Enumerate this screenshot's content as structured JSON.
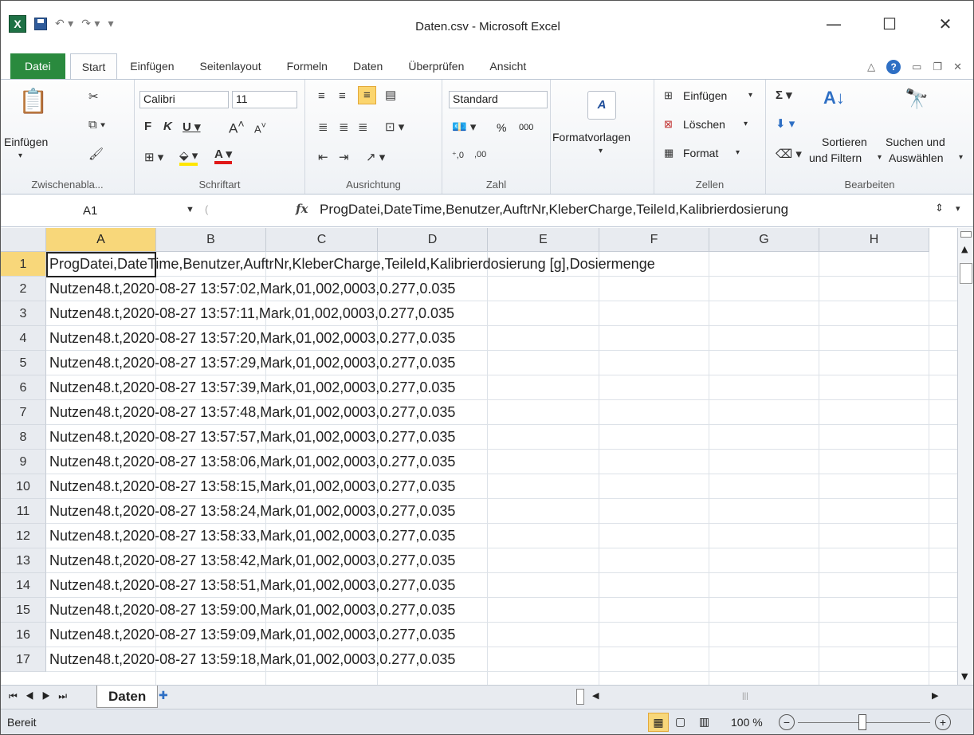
{
  "window": {
    "title": "Daten.csv - Microsoft Excel"
  },
  "tabs": [
    "Datei",
    "Start",
    "Einfügen",
    "Seitenlayout",
    "Formeln",
    "Daten",
    "Überprüfen",
    "Ansicht"
  ],
  "ribbon": {
    "clipboard": {
      "paste": "Einfügen",
      "label": "Zwischenabla..."
    },
    "font": {
      "name": "Calibri",
      "size": "11",
      "label": "Schriftart"
    },
    "align": {
      "label": "Ausrichtung"
    },
    "number": {
      "format": "Standard",
      "percent": "%",
      "thousands": "000",
      "label": "Zahl"
    },
    "styles": {
      "label": "Formatvorlagen"
    },
    "cells": {
      "insert": "Einfügen",
      "delete": "Löschen",
      "format": "Format",
      "label": "Zellen"
    },
    "editing": {
      "sort": "Sortieren",
      "filter": "und Filtern",
      "find": "Suchen und",
      "select": "Auswählen",
      "label": "Bearbeiten"
    }
  },
  "formula_bar": {
    "cell": "A1",
    "fx": "fx",
    "content": "ProgDatei,DateTime,Benutzer,AuftrNr,KleberCharge,TeileId,Kalibrierdosierung"
  },
  "columns": [
    "A",
    "B",
    "C",
    "D",
    "E",
    "F",
    "G",
    "H"
  ],
  "rows": [
    {
      "n": "1",
      "v": "ProgDatei,DateTime,Benutzer,AuftrNr,KleberCharge,TeileId,Kalibrierdosierung [g],Dosiermenge"
    },
    {
      "n": "2",
      "v": "Nutzen48.t,2020-08-27 13:57:02,Mark,01,002,0003,0.277,0.035"
    },
    {
      "n": "3",
      "v": "Nutzen48.t,2020-08-27 13:57:11,Mark,01,002,0003,0.277,0.035"
    },
    {
      "n": "4",
      "v": "Nutzen48.t,2020-08-27 13:57:20,Mark,01,002,0003,0.277,0.035"
    },
    {
      "n": "5",
      "v": "Nutzen48.t,2020-08-27 13:57:29,Mark,01,002,0003,0.277,0.035"
    },
    {
      "n": "6",
      "v": "Nutzen48.t,2020-08-27 13:57:39,Mark,01,002,0003,0.277,0.035"
    },
    {
      "n": "7",
      "v": "Nutzen48.t,2020-08-27 13:57:48,Mark,01,002,0003,0.277,0.035"
    },
    {
      "n": "8",
      "v": "Nutzen48.t,2020-08-27 13:57:57,Mark,01,002,0003,0.277,0.035"
    },
    {
      "n": "9",
      "v": "Nutzen48.t,2020-08-27 13:58:06,Mark,01,002,0003,0.277,0.035"
    },
    {
      "n": "10",
      "v": "Nutzen48.t,2020-08-27 13:58:15,Mark,01,002,0003,0.277,0.035"
    },
    {
      "n": "11",
      "v": "Nutzen48.t,2020-08-27 13:58:24,Mark,01,002,0003,0.277,0.035"
    },
    {
      "n": "12",
      "v": "Nutzen48.t,2020-08-27 13:58:33,Mark,01,002,0003,0.277,0.035"
    },
    {
      "n": "13",
      "v": "Nutzen48.t,2020-08-27 13:58:42,Mark,01,002,0003,0.277,0.035"
    },
    {
      "n": "14",
      "v": "Nutzen48.t,2020-08-27 13:58:51,Mark,01,002,0003,0.277,0.035"
    },
    {
      "n": "15",
      "v": "Nutzen48.t,2020-08-27 13:59:00,Mark,01,002,0003,0.277,0.035"
    },
    {
      "n": "16",
      "v": "Nutzen48.t,2020-08-27 13:59:09,Mark,01,002,0003,0.277,0.035"
    },
    {
      "n": "17",
      "v": "Nutzen48.t,2020-08-27 13:59:18,Mark,01,002,0003,0.277,0.035"
    }
  ],
  "sheet": {
    "name": "Daten"
  },
  "status": {
    "ready": "Bereit",
    "zoom": "100 %"
  }
}
